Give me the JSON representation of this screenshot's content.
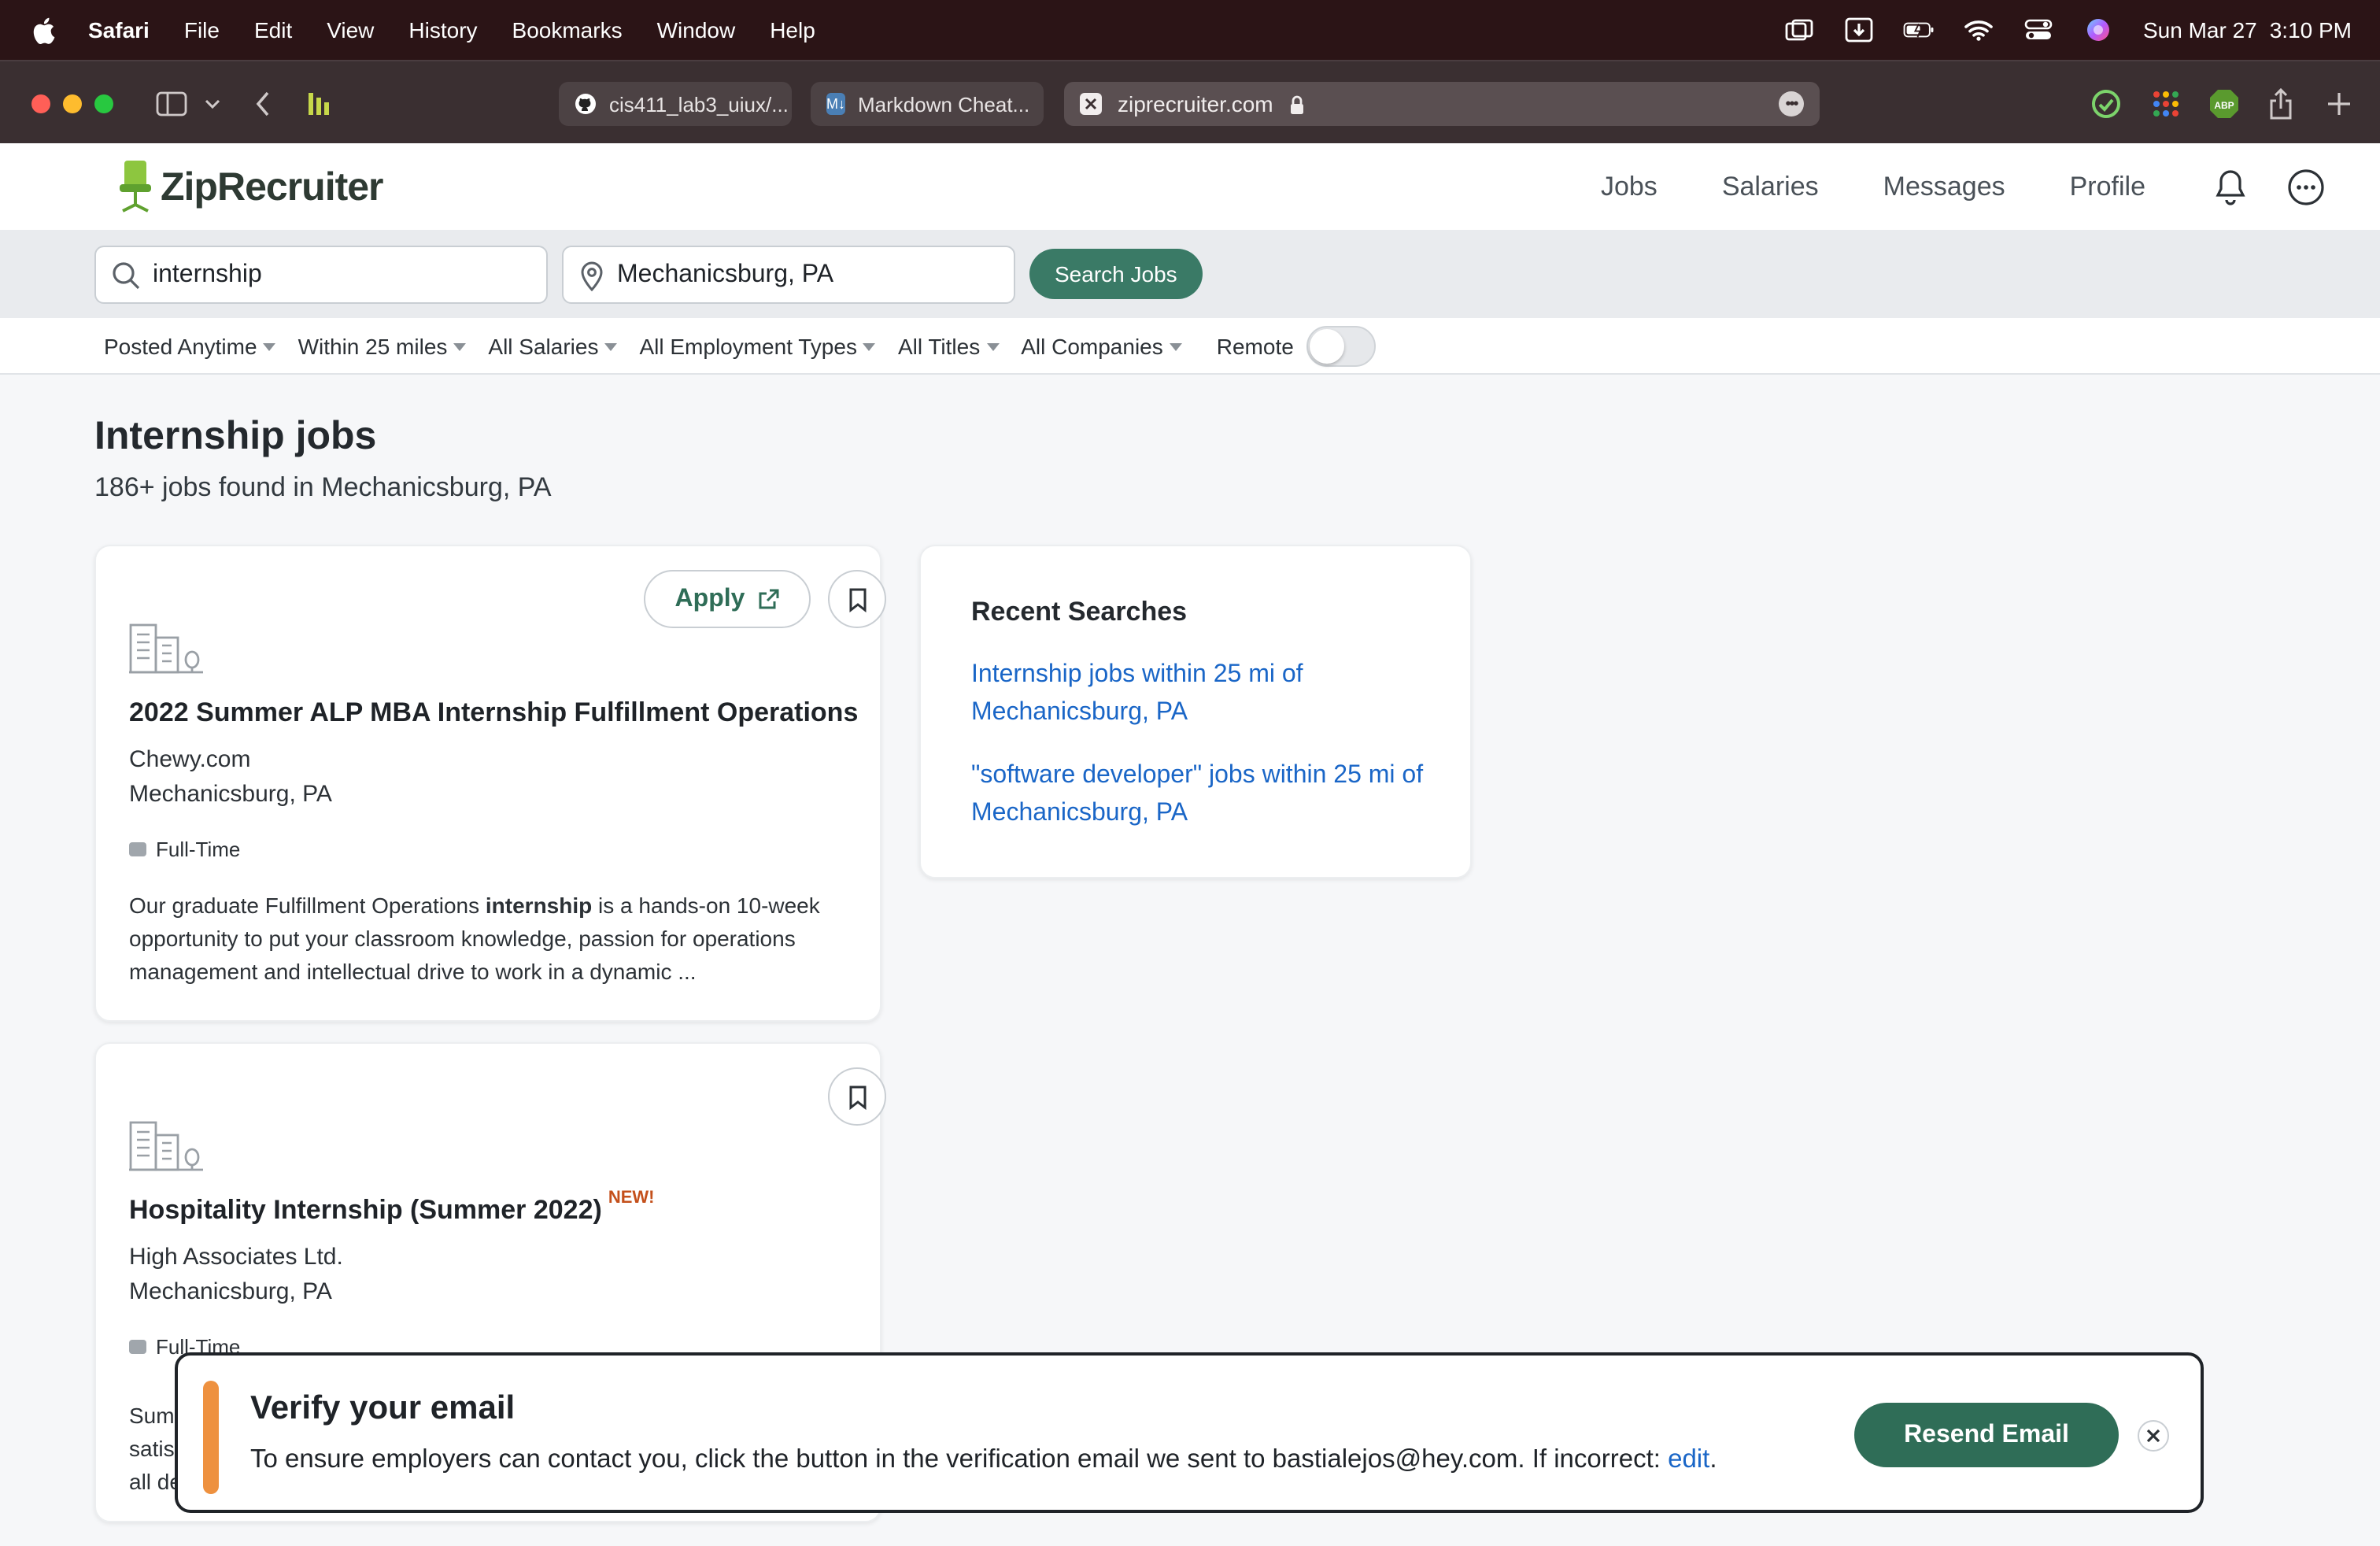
{
  "menubar": {
    "app": "Safari",
    "items": [
      "File",
      "Edit",
      "View",
      "History",
      "Bookmarks",
      "Window",
      "Help"
    ],
    "date": "Sun Mar 27",
    "time": "3:10 PM"
  },
  "browser": {
    "tabs": [
      {
        "label": "cis411_lab3_uiux/..."
      },
      {
        "label": "Markdown Cheat..."
      }
    ],
    "url": "ziprecruiter.com"
  },
  "site": {
    "logo": "ZipRecruiter",
    "nav": [
      "Jobs",
      "Salaries",
      "Messages",
      "Profile"
    ]
  },
  "search": {
    "keyword": "internship",
    "location": "Mechanicsburg, PA",
    "button": "Search Jobs"
  },
  "filters": {
    "posted": "Posted Anytime",
    "distance": "Within 25 miles",
    "salary": "All Salaries",
    "employment": "All Employment Types",
    "titles": "All Titles",
    "companies": "All Companies",
    "remote": "Remote"
  },
  "main": {
    "title": "Internship jobs",
    "count": "186+ jobs found in Mechanicsburg, PA"
  },
  "jobs": [
    {
      "apply": "Apply",
      "title": "2022 Summer ALP MBA Internship Fulfillment Operations",
      "company": "Chewy.com",
      "location": "Mechanicsburg, PA",
      "type": "Full-Time",
      "snippet_pre": "Our graduate Fulfillment Operations ",
      "snippet_bold": "internship",
      "snippet_post": " is a hands-on 10-week opportunity to put your classroom knowledge, passion for operations management and intellectual drive to work in a dynamic ..."
    },
    {
      "title": "Hospitality Internship (Summer 2022)",
      "badge": "NEW!",
      "company": "High Associates Ltd.",
      "location": "Mechanicsburg, PA",
      "type": "Full-Time",
      "snippet_l1": "Sumr",
      "snippet_l2": "satis",
      "snippet_l3": "all de"
    }
  ],
  "recent": {
    "title": "Recent Searches",
    "items": [
      "Internship jobs within 25 mi of Mechanicsburg, PA",
      "\"software developer\" jobs within 25 mi of Mechanicsburg, PA"
    ]
  },
  "toast": {
    "title": "Verify your email",
    "body": "To ensure employers can contact you, click the button in the verification email we sent to bastialejos@hey.com. If incorrect: ",
    "edit": "edit",
    "period": ".",
    "button": "Resend Email",
    "accent": "#ee913f"
  },
  "colors": {
    "brand_green": "#2f6d57",
    "link_blue": "#1a66c7"
  }
}
